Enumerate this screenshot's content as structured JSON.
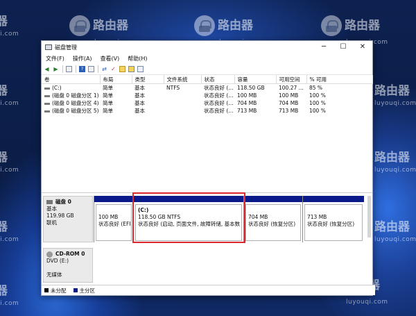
{
  "watermark": {
    "brand": "路由器",
    "site": "luyouqi.com"
  },
  "window": {
    "title": "磁盘管理",
    "min": "─",
    "max": "☐",
    "close": "✕"
  },
  "menu": [
    "文件(F)",
    "操作(A)",
    "查看(V)",
    "帮助(H)"
  ],
  "volume_table": {
    "columns": [
      "卷",
      "布局",
      "类型",
      "文件系统",
      "状态",
      "容量",
      "可用空间",
      "% 可用"
    ],
    "rows": [
      [
        "(C:)",
        "简单",
        "基本",
        "NTFS",
        "状态良好 (...",
        "118.50 GB",
        "100.27 ...",
        "85 %"
      ],
      [
        "(磁盘 0 磁盘分区 1)",
        "简单",
        "基本",
        "",
        "状态良好 (...",
        "100 MB",
        "100 MB",
        "100 %"
      ],
      [
        "(磁盘 0 磁盘分区 4)",
        "简单",
        "基本",
        "",
        "状态良好 (...",
        "704 MB",
        "704 MB",
        "100 %"
      ],
      [
        "(磁盘 0 磁盘分区 5)",
        "简单",
        "基本",
        "",
        "状态良好 (...",
        "713 MB",
        "713 MB",
        "100 %"
      ]
    ]
  },
  "disk0": {
    "name": "磁盘 0",
    "type": "基本",
    "size": "119.98 GB",
    "status": "联机",
    "partitions": [
      {
        "title": "",
        "size": "100 MB",
        "status": "状态良好 (EFI"
      },
      {
        "title": "(C:)",
        "size": "118.50 GB NTFS",
        "status": "状态良好 (启动, 页面文件, 故障转储, 基本数"
      },
      {
        "title": "",
        "size": "704 MB",
        "status": "状态良好 (恢复分区)"
      },
      {
        "title": "",
        "size": "713 MB",
        "status": "状态良好 (恢复分区)"
      }
    ]
  },
  "cdrom0": {
    "name": "CD-ROM 0",
    "drive": "DVD (E:)",
    "status": "无媒体"
  },
  "legend": [
    {
      "label": "未分配",
      "color": "#000000"
    },
    {
      "label": "主分区",
      "color": "#0b1a8a"
    }
  ],
  "colors": {
    "highlight": "#e0272b",
    "partition_band": "#0b1a8a"
  }
}
